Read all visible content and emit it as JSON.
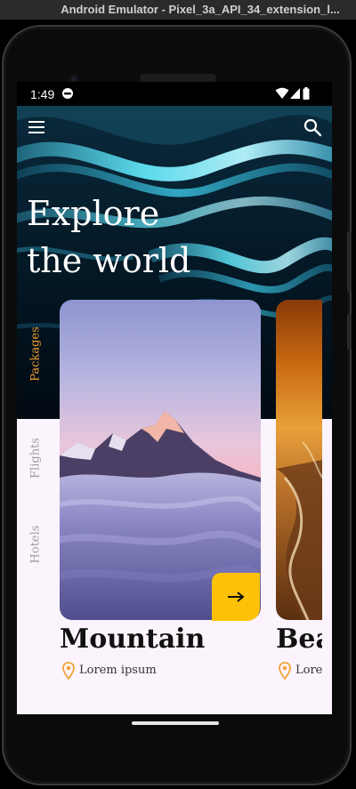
{
  "window": {
    "title": "Android Emulator - Pixel_3a_API_34_extension_l..."
  },
  "status_bar": {
    "time": "1:49"
  },
  "hero": {
    "title_line1": "Explore",
    "title_line2": "the world"
  },
  "tabs": [
    {
      "label": "Packages",
      "selected": true
    },
    {
      "label": "Flights",
      "selected": false
    },
    {
      "label": "Hotels",
      "selected": false
    }
  ],
  "cards": [
    {
      "title": "Mountain",
      "location": "Lorem ipsum"
    },
    {
      "title": "Bea",
      "location": "Lorem"
    }
  ],
  "colors": {
    "accent": "#ffc107",
    "location_pin": "#f2a33a",
    "tab_active": "#e89a2c",
    "tab_inactive": "#9e9e9e",
    "panel_bg": "#fcf4fc"
  }
}
